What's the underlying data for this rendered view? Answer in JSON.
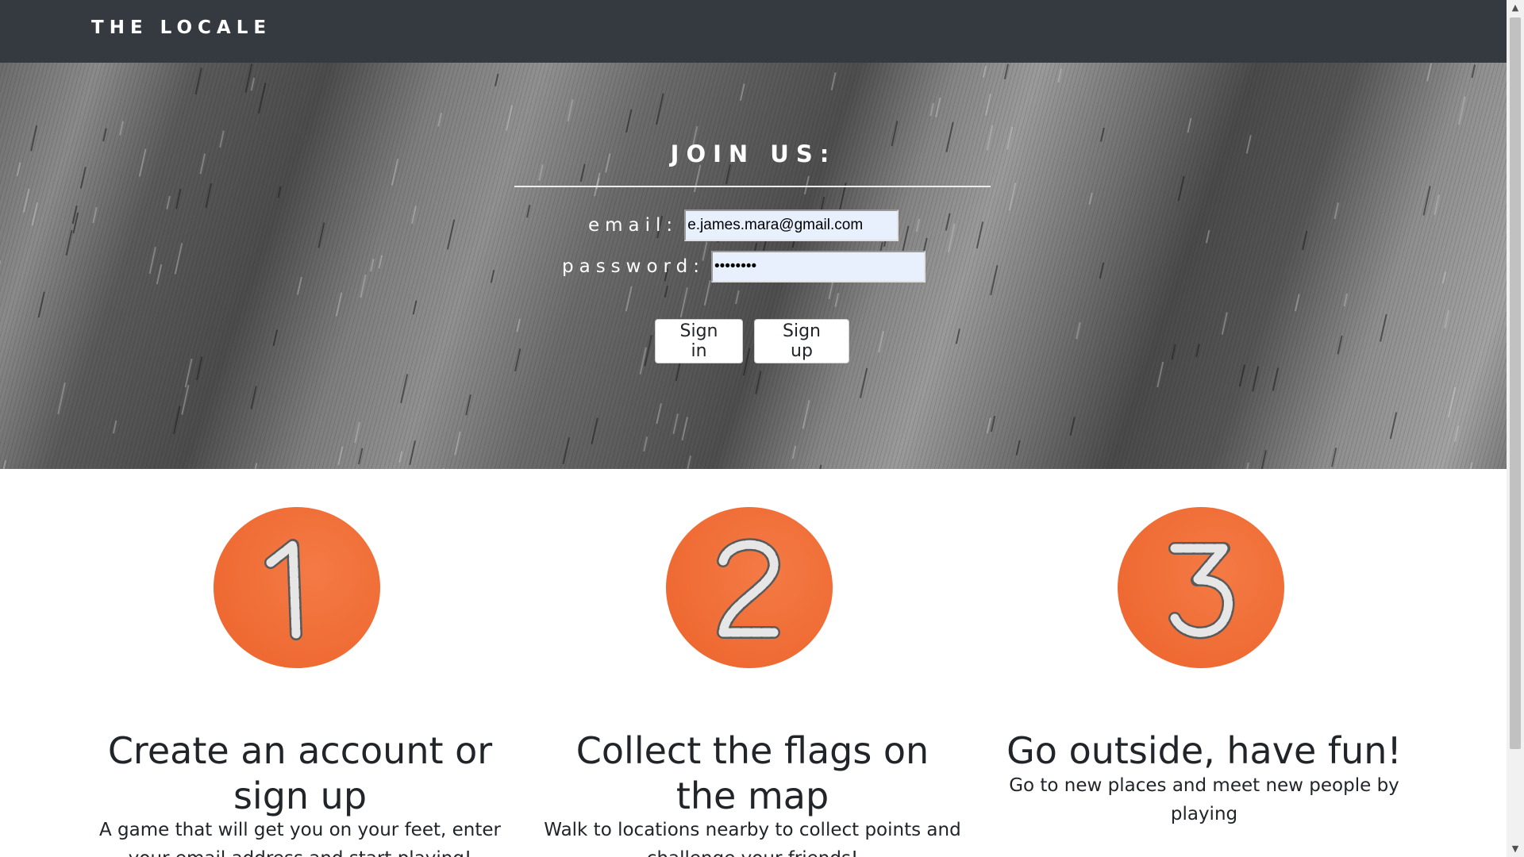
{
  "navbar": {
    "brand": "THE LOCALE"
  },
  "hero": {
    "title": "JOIN US:",
    "email_label": "email:",
    "email_value": "e.james.mara@gmail.com",
    "password_label": "password:",
    "password_value": "••••••••",
    "signin_label": "Sign in",
    "signup_label": "Sign up"
  },
  "steps": [
    {
      "number": "1",
      "title": "Create an account or sign up",
      "text": "A game that will get you on your feet, enter your email address and start playing!"
    },
    {
      "number": "2",
      "title": "Collect the flags on the map",
      "text": "Walk to locations nearby to collect points and challenge your friends!"
    },
    {
      "number": "3",
      "title": "Go outside, have fun!",
      "text": "Go to new places and meet new people by playing"
    }
  ],
  "colors": {
    "navbar": "#343a40",
    "accent": "#ef6a33",
    "text": "#212529"
  },
  "icons": {
    "scroll_up": "triangle-up-icon",
    "scroll_down": "triangle-down-icon"
  }
}
